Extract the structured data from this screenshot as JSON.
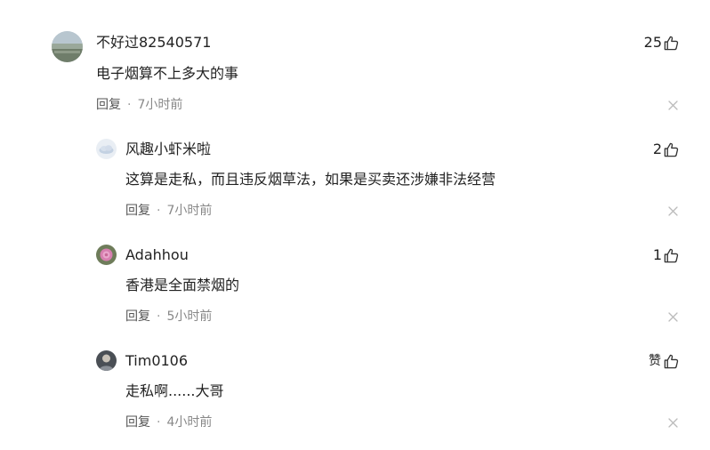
{
  "comments": [
    {
      "username": "不好过82540571",
      "text": "电子烟算不上多大的事",
      "reply_label": "回复",
      "separator": "·",
      "time": "7小时前",
      "likes": "25",
      "avatar": "landscape-avatar"
    },
    {
      "username": "风趣小虾米啦",
      "text": "这算是走私，而且违反烟草法，如果是买卖还涉嫌非法经营",
      "reply_label": "回复",
      "separator": "·",
      "time": "7小时前",
      "likes": "2",
      "avatar": "cloud-avatar"
    },
    {
      "username": "Adahhou",
      "text": "香港是全面禁烟的",
      "reply_label": "回复",
      "separator": "·",
      "time": "5小时前",
      "likes": "1",
      "avatar": "flower-avatar"
    },
    {
      "username": "Tim0106",
      "text": "走私啊......大哥",
      "reply_label": "回复",
      "separator": "·",
      "time": "4小时前",
      "likes": "赞",
      "avatar": "portrait-avatar"
    }
  ],
  "icons": {
    "like": "thumbs-up-icon",
    "close": "close-icon"
  },
  "colors": {
    "text": "#222222",
    "meta": "#888888",
    "icon": "#333333",
    "close": "#bbbbbb"
  }
}
